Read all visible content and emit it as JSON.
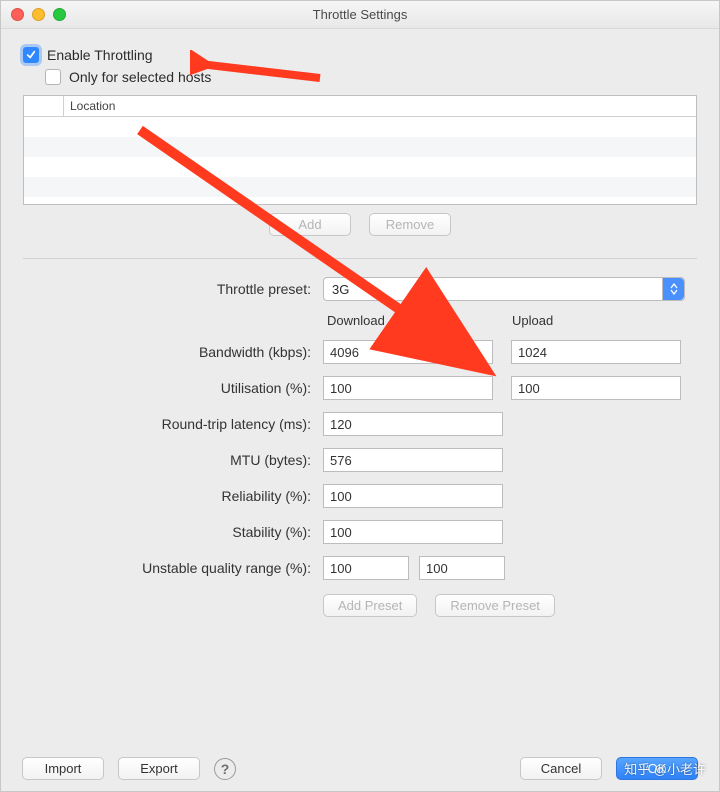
{
  "window": {
    "title": "Throttle Settings"
  },
  "checks": {
    "enable_label": "Enable Throttling",
    "only_selected_label": "Only for selected hosts"
  },
  "hosts": {
    "col_location": "Location",
    "add": "Add",
    "remove": "Remove"
  },
  "preset": {
    "label": "Throttle preset:",
    "value": "3G"
  },
  "columns": {
    "download": "Download",
    "upload": "Upload"
  },
  "fields": {
    "bandwidth": {
      "label": "Bandwidth (kbps):",
      "download": "4096",
      "upload": "1024"
    },
    "utilisation": {
      "label": "Utilisation (%):",
      "download": "100",
      "upload": "100"
    },
    "latency": {
      "label": "Round-trip latency (ms):",
      "value": "120"
    },
    "mtu": {
      "label": "MTU (bytes):",
      "value": "576"
    },
    "reliability": {
      "label": "Reliability (%):",
      "value": "100"
    },
    "stability": {
      "label": "Stability (%):",
      "value": "100"
    },
    "uqr": {
      "label": "Unstable quality range (%):",
      "min": "100",
      "max": "100"
    }
  },
  "preset_buttons": {
    "add": "Add Preset",
    "remove": "Remove Preset"
  },
  "footer": {
    "import": "Import",
    "export": "Export",
    "cancel": "Cancel",
    "ok": "OK"
  },
  "watermark": "知乎 @小老许"
}
